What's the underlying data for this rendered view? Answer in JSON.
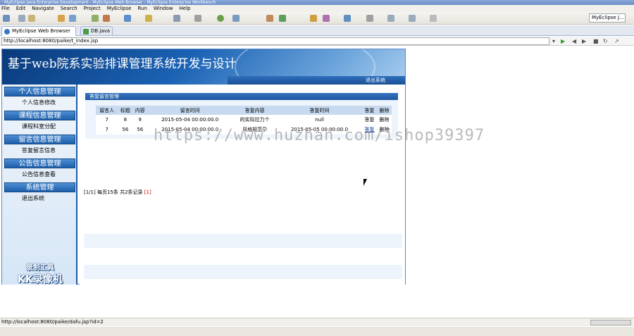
{
  "window": {
    "title": "MyEclipse Java Enterprise Development - MyEclipse Web Browser - MyEclipse Enterprise Workbench"
  },
  "menubar": [
    "File",
    "Edit",
    "Navigate",
    "Search",
    "Project",
    "MyEclipse",
    "Run",
    "Window",
    "Help"
  ],
  "toolbar": {
    "perspective": "MyEclipse J..."
  },
  "tabs": [
    {
      "label": "MyEclipse Web Browser",
      "active": true
    },
    {
      "label": "DB.java",
      "active": false
    }
  ],
  "address": {
    "url": "http://localhost:8080/paike/t_index.jsp"
  },
  "app": {
    "title": "基于web院系实验排课管理系统开发与设计",
    "logout": "退出系统",
    "sidebar": [
      {
        "heading": "个人信息管理",
        "items": [
          "个人信息修改"
        ]
      },
      {
        "heading": "课程信息管理",
        "items": [
          "课程科室分配"
        ]
      },
      {
        "heading": "留言信息管理",
        "items": [
          "答复留言信息"
        ]
      },
      {
        "heading": "公告信息管理",
        "items": [
          "公告信息查看"
        ]
      },
      {
        "heading": "系统管理",
        "items": [
          "退出系统"
        ]
      }
    ],
    "logo": {
      "line1": "录制工具",
      "line2": "KK录像机"
    },
    "panel": {
      "title": "答复留言管理",
      "columns": [
        "留言人",
        "标题",
        "内容",
        "留言时间",
        "答复内容",
        "答复时间",
        "答复",
        "删除"
      ],
      "rows": [
        [
          "7",
          "8",
          "9",
          "2015-05-04 00:00:00.0",
          "的实际拉力个",
          "null",
          "答复",
          "删除"
        ],
        [
          "7",
          "56",
          "56",
          "2015-05-04 00:00:00.0",
          "风格规范尕",
          "2015-05-05 00:00:00.0",
          "答复",
          "删除"
        ]
      ],
      "pager": {
        "text": "[1/1] 每页15条 共2条记录",
        "link": "[1]"
      }
    }
  },
  "watermark": "https://www.huzhan.com/ishop39397",
  "status": {
    "text": "http://localhost:8080/paike/dafu.jsp?id=2"
  }
}
